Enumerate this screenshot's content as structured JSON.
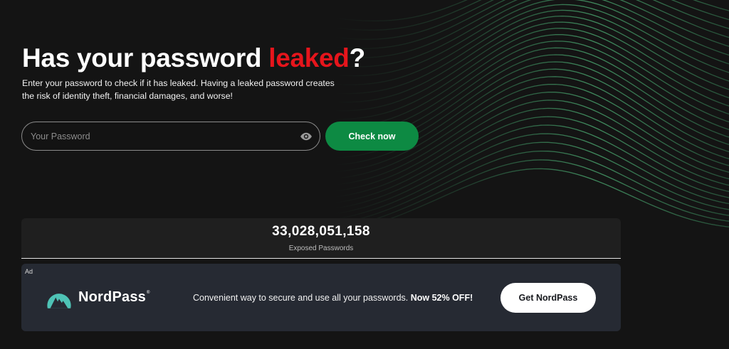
{
  "hero": {
    "title_before": "Has your password ",
    "title_accent": "leaked",
    "title_after": "?",
    "accent_color": "#e6151c",
    "description": "Enter your password to check if it has leaked. Having a leaked password creates the risk of identity theft, financial damages, and worse!"
  },
  "password_form": {
    "placeholder": "Your Password",
    "value": "",
    "toggle_icon": "eye-icon",
    "submit_label": "Check now",
    "submit_color": "#0d8a43"
  },
  "stats": {
    "count": "33,028,051,158",
    "label": "Exposed Passwords"
  },
  "ad": {
    "tag": "Ad",
    "brand_name": "NordPass",
    "brand_mark": "®",
    "brand_color": "#4ec3b6",
    "text_regular": "Convenient way to secure and use all your passwords. ",
    "text_bold": "Now 52% OFF!",
    "cta_label": "Get NordPass"
  },
  "colors": {
    "background": "#141414",
    "wave_line": "#3fa36a"
  }
}
